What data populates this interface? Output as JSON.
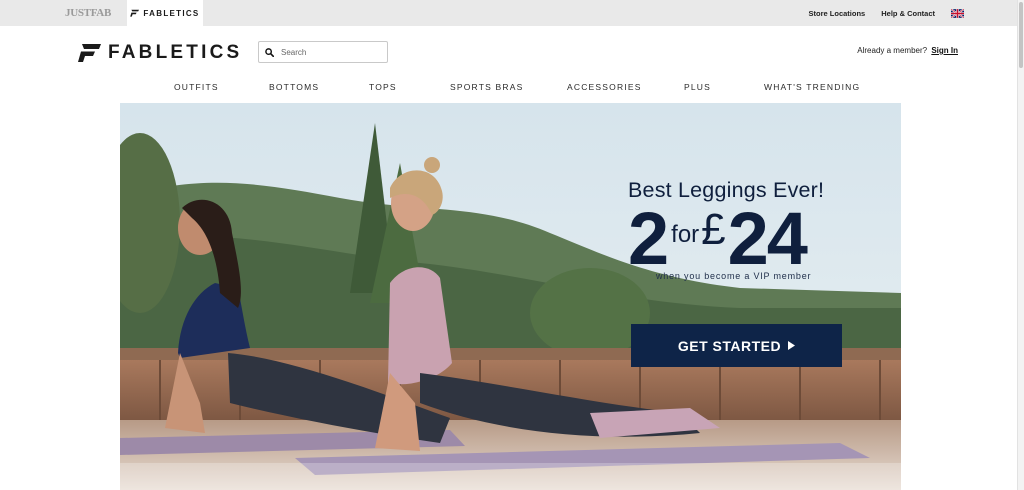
{
  "topbar": {
    "brands": [
      {
        "label": "JUSTFAB"
      },
      {
        "label": "FABLETICS"
      }
    ],
    "links": {
      "store_locations": "Store Locations",
      "help_contact": "Help & Contact"
    },
    "flag_icon": "uk-flag-icon"
  },
  "header": {
    "logo_text": "FABLETICS",
    "search": {
      "placeholder": "Search",
      "value": ""
    },
    "member_prompt": "Already a member?",
    "sign_in": "Sign In"
  },
  "nav": {
    "items": [
      {
        "label": "OUTFITS"
      },
      {
        "label": "BOTTOMS"
      },
      {
        "label": "TOPS"
      },
      {
        "label": "SPORTS BRAS"
      },
      {
        "label": "ACCESSORIES"
      },
      {
        "label": "PLUS"
      },
      {
        "label": "WHAT'S TRENDING"
      }
    ]
  },
  "hero": {
    "title": "Best Leggings Ever!",
    "quantity": "2",
    "for": "for",
    "currency": "£",
    "price": "24",
    "subtitle": "when you become a VIP member",
    "cta_label": "GET STARTED"
  },
  "colors": {
    "navy": "#0e2448",
    "topbar_bg": "#e9e9e9",
    "text": "#1a1a1a"
  }
}
